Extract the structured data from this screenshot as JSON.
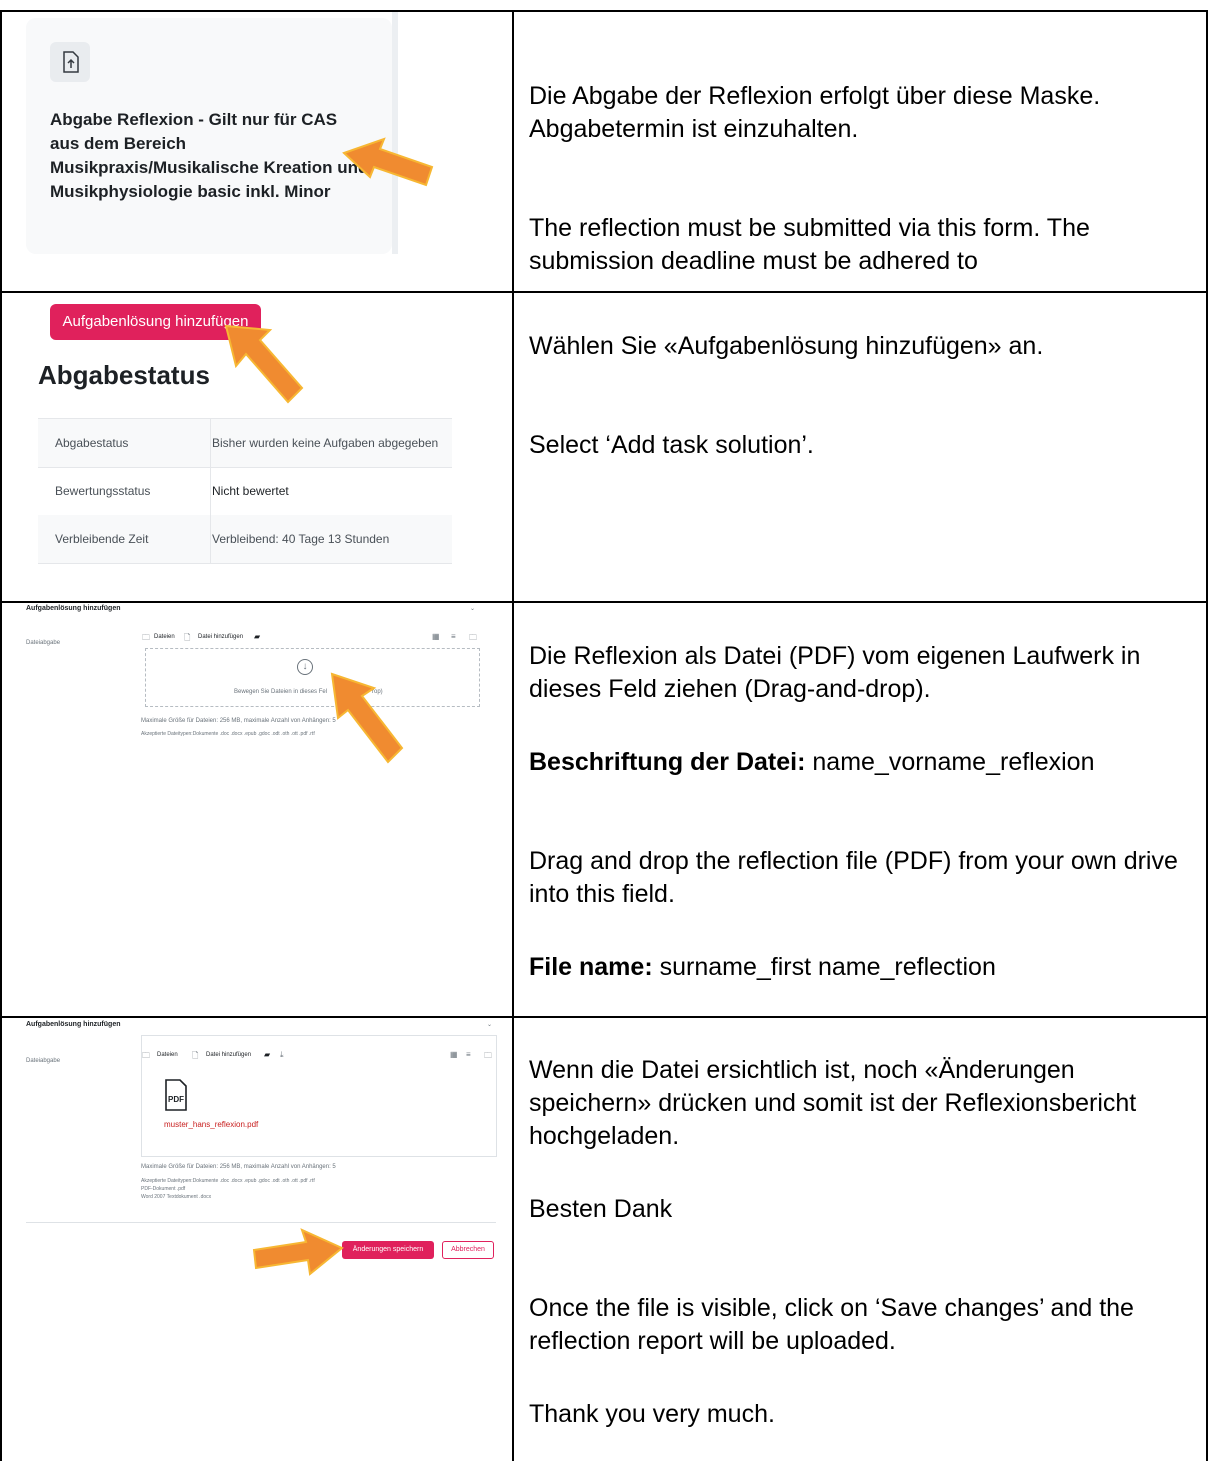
{
  "row1": {
    "card_title": "Abgabe Reflexion - Gilt nur für CAS aus dem Bereich Musikpraxis/Musikalische Kreation und Musikphysiologie basic inkl. Minor",
    "de": "Die Abgabe der Reflexion erfolgt über diese Maske. Abgabetermin ist einzuhalten.",
    "en": "The reflection must be submitted via this form. The submission deadline must be adhered to"
  },
  "row2": {
    "button": "Aufgabenlösung hinzufügen",
    "heading": "Abgabestatus",
    "table": [
      {
        "key": "Abgabestatus",
        "value": "Bisher wurden keine Aufgaben abgegeben"
      },
      {
        "key": "Bewertungsstatus",
        "value": "Nicht bewertet"
      },
      {
        "key": "Verbleibende Zeit",
        "value": "Verbleibend: 40 Tage 13 Stunden"
      }
    ],
    "de": "Wählen Sie «Aufgabenlösung hinzufügen» an.",
    "en": "Select ‘Add task solution’."
  },
  "row3": {
    "panel_title": "Aufgabenlösung hinzufügen",
    "field_label": "Dateiabgabe",
    "files": "Dateien",
    "add_file": "Datei hinzufügen",
    "drop_text": "Bewegen Sie Dateien in dieses Fel",
    "drop_text_tail": "rop)",
    "limits": "Maximale Größe für Dateien: 256 MB, maximale Anzahl von Anhängen: 5",
    "accepted": "Akzeptierte Dateitypen:Dokumente .doc .docx .epub .gdoc .odt .oth .ott .pdf .rtf",
    "de": "Die Reflexion als Datei (PDF) vom eigenen Laufwerk in dieses Feld ziehen (Drag-and-drop).",
    "de_label": "Beschriftung der Datei:",
    "de_value": " name_vorname_reflexion",
    "en": "Drag and drop the reflection file (PDF) from your own drive into this field.",
    "en_label": "File name:",
    "en_value": " surname_first name_reflection"
  },
  "row4": {
    "panel_title": "Aufgabenlösung hinzufügen",
    "field_label": "Dateiabgabe",
    "files": "Dateien",
    "add_file": "Datei hinzufügen",
    "filename": "muster_hans_reflexion.pdf",
    "pdf_label": "PDF",
    "limits": "Maximale Größe für Dateien: 256 MB, maximale Anzahl von Anhängen: 5",
    "accepted1": "Akzeptierte Dateitypen:Dokumente .doc .docx .epub .gdoc .odt .oth .ott .pdf .rtf",
    "accepted2": "PDF-Dokument .pdf",
    "accepted3": "Word 2007 Textdokument .docx",
    "save": "Änderungen speichern",
    "cancel": "Abbrechen",
    "de": "Wenn die Datei ersichtlich ist, noch «Änderungen speichern» drücken und somit ist der Reflexionsbericht hochgeladen.",
    "de_thanks": "Besten Dank",
    "en": "Once the file is visible, click on ‘Save changes’ and the reflection report will be uploaded.",
    "en_thanks": "Thank you very much."
  },
  "colors": {
    "accent": "#e0215c",
    "arrow": "#f08b30",
    "arrow_outline": "#f7b733"
  },
  "icons": [
    "upload-icon",
    "arrow-pointer",
    "folder-icon",
    "file-icon",
    "download-icon",
    "grid-icon",
    "list-icon",
    "pdf-icon",
    "chevron-down-icon"
  ]
}
